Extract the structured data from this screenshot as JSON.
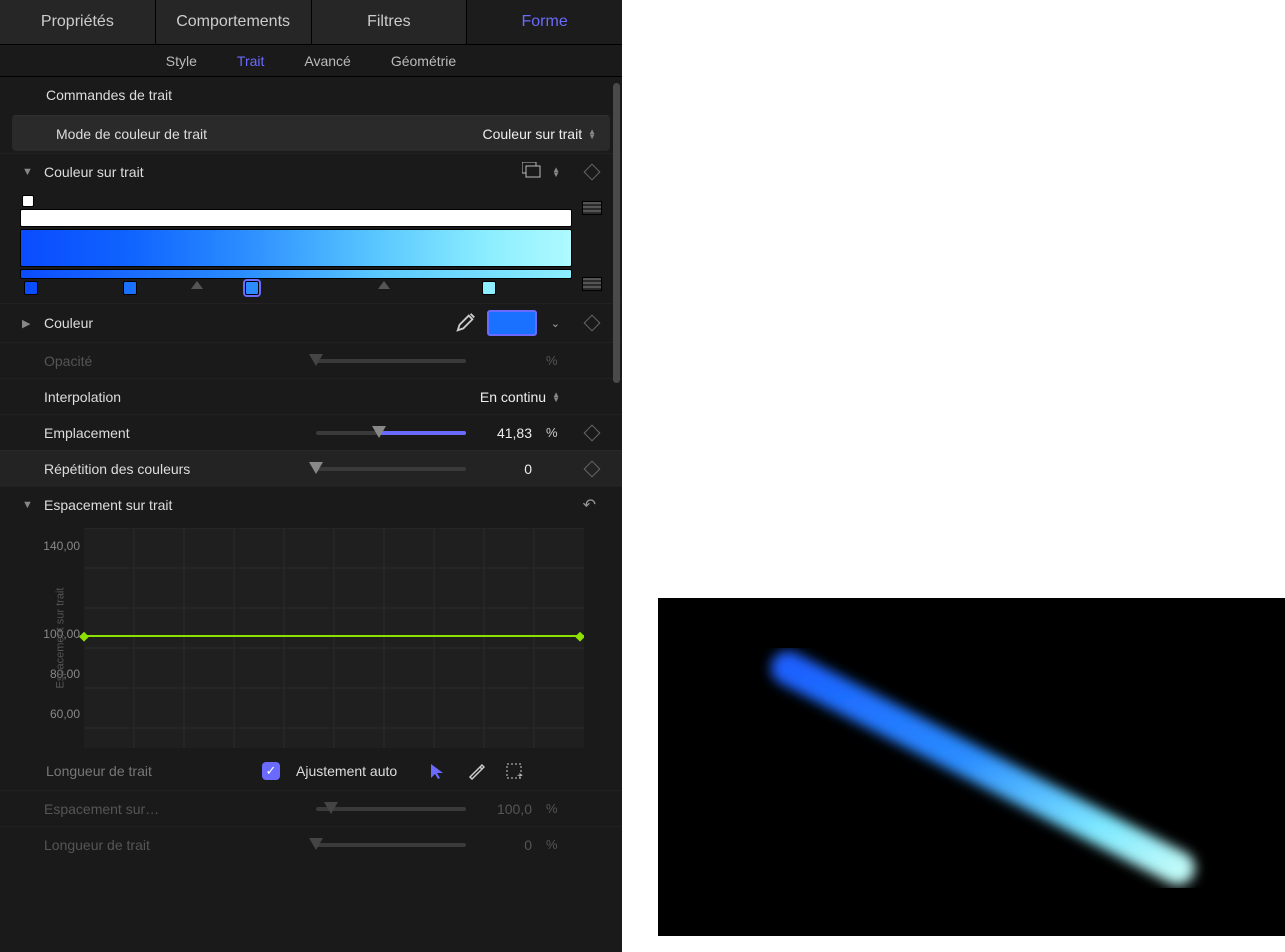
{
  "tabs": {
    "properties": "Propriétés",
    "behaviors": "Comportements",
    "filters": "Filtres",
    "shape": "Forme"
  },
  "subtabs": {
    "style": "Style",
    "stroke": "Trait",
    "advanced": "Avancé",
    "geometry": "Géométrie"
  },
  "sections": {
    "stroke_controls": "Commandes de trait",
    "color_mode_label": "Mode de couleur de trait",
    "color_mode_value": "Couleur sur trait",
    "color_over_stroke": "Couleur sur trait",
    "color": "Couleur",
    "opacity": "Opacité",
    "opacity_unit": "%",
    "interpolation_label": "Interpolation",
    "interpolation_value": "En continu",
    "location_label": "Emplacement",
    "location_value": "41,83",
    "location_unit": "%",
    "repeat_label": "Répétition des couleurs",
    "repeat_value": "0",
    "spacing_over_stroke": "Espacement sur trait",
    "graph_ylabel": "Espacement sur trait",
    "graph_ticks": {
      "a": "140,00",
      "b": "100,00",
      "c": "80,00",
      "d": "60,00"
    },
    "stroke_length": "Longueur de trait",
    "auto_fit": "Ajustement auto",
    "spacing_on_label": "Espacement sur…",
    "spacing_on_value": "100,0",
    "spacing_on_unit": "%",
    "stroke_length2_label": "Longueur de trait",
    "stroke_length2_value": "0",
    "stroke_length2_unit": "%"
  },
  "gradient": {
    "stops": [
      {
        "pos": 2,
        "color": "#0a4cff"
      },
      {
        "pos": 20,
        "color": "#1a70ff"
      },
      {
        "pos": 42,
        "color": "#2a8cff",
        "selected": true
      },
      {
        "pos": 85,
        "color": "#8ceeff"
      }
    ],
    "midpoints": [
      32,
      66
    ]
  },
  "chart_data": {
    "type": "line",
    "title": "",
    "xlabel": "",
    "ylabel": "Espacement sur trait",
    "ylim": [
      40,
      150
    ],
    "yticks": [
      60,
      80,
      100,
      140
    ],
    "series": [
      {
        "name": "Espacement",
        "x": [
          0,
          100
        ],
        "y": [
          100,
          100
        ]
      }
    ]
  }
}
